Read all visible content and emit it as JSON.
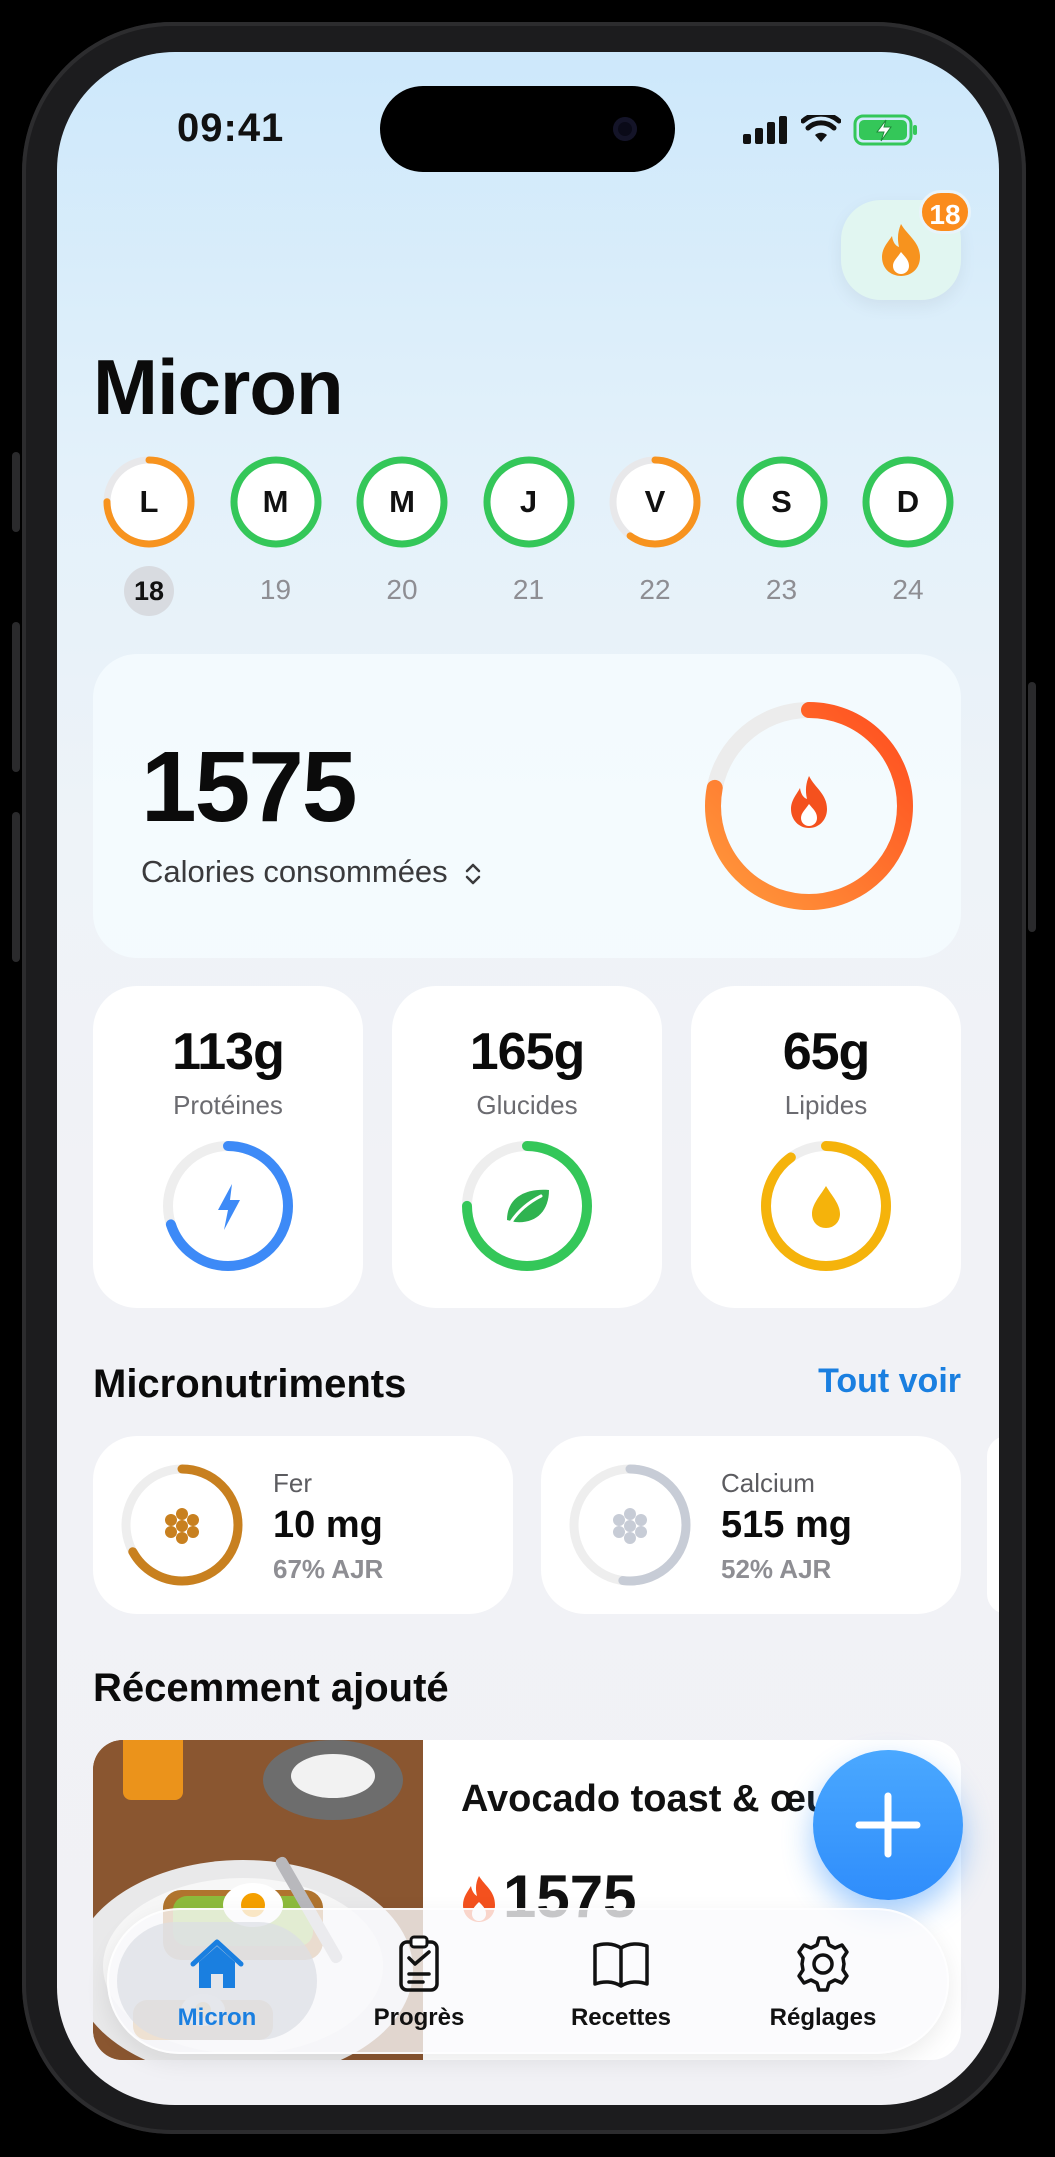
{
  "status_bar": {
    "time": "09:41"
  },
  "streak": {
    "count": "18",
    "icon": "flame-icon"
  },
  "header": {
    "title": "Micron"
  },
  "week": [
    {
      "letter": "L",
      "date": "18",
      "today": true,
      "color": "#f7931e",
      "progress": 0.75
    },
    {
      "letter": "M",
      "date": "19",
      "today": false,
      "color": "#34c759",
      "progress": 1.0
    },
    {
      "letter": "M",
      "date": "20",
      "today": false,
      "color": "#34c759",
      "progress": 1.0
    },
    {
      "letter": "J",
      "date": "21",
      "today": false,
      "color": "#34c759",
      "progress": 1.0
    },
    {
      "letter": "V",
      "date": "22",
      "today": false,
      "color": "#f7931e",
      "progress": 0.6
    },
    {
      "letter": "S",
      "date": "23",
      "today": false,
      "color": "#34c759",
      "progress": 1.0
    },
    {
      "letter": "D",
      "date": "24",
      "today": false,
      "color": "#34c759",
      "progress": 1.0
    }
  ],
  "calories": {
    "value": "1575",
    "label": "Calories consommées",
    "progress": 0.78,
    "icon": "flame-icon"
  },
  "macros": [
    {
      "value": "113g",
      "label": "Protéines",
      "color": "#3d8af7",
      "progress": 0.7,
      "icon": "lightning-icon"
    },
    {
      "value": "165g",
      "label": "Glucides",
      "color": "#34c759",
      "progress": 0.75,
      "icon": "leaf-icon"
    },
    {
      "value": "65g",
      "label": "Lipides",
      "color": "#f5b30b",
      "progress": 0.9,
      "icon": "drop-icon"
    }
  ],
  "micronutrients": {
    "title": "Micronutriments",
    "see_all": "Tout voir",
    "items": [
      {
        "name": "Fer",
        "value": "10 mg",
        "pct": "67% AJR",
        "color": "#c8801f",
        "progress": 0.67
      },
      {
        "name": "Calcium",
        "value": "515 mg",
        "pct": "52% AJR",
        "color": "#c7ccd6",
        "progress": 0.52
      }
    ]
  },
  "recent": {
    "title": "Récemment ajouté",
    "items": [
      {
        "name": "Avocado toast & œufs",
        "kcal": "1575"
      }
    ]
  },
  "tabbar": {
    "tabs": [
      {
        "label": "Micron",
        "icon": "home-icon"
      },
      {
        "label": "Progrès",
        "icon": "clipboard-icon"
      },
      {
        "label": "Recettes",
        "icon": "book-icon"
      },
      {
        "label": "Réglages",
        "icon": "gear-icon"
      }
    ]
  }
}
